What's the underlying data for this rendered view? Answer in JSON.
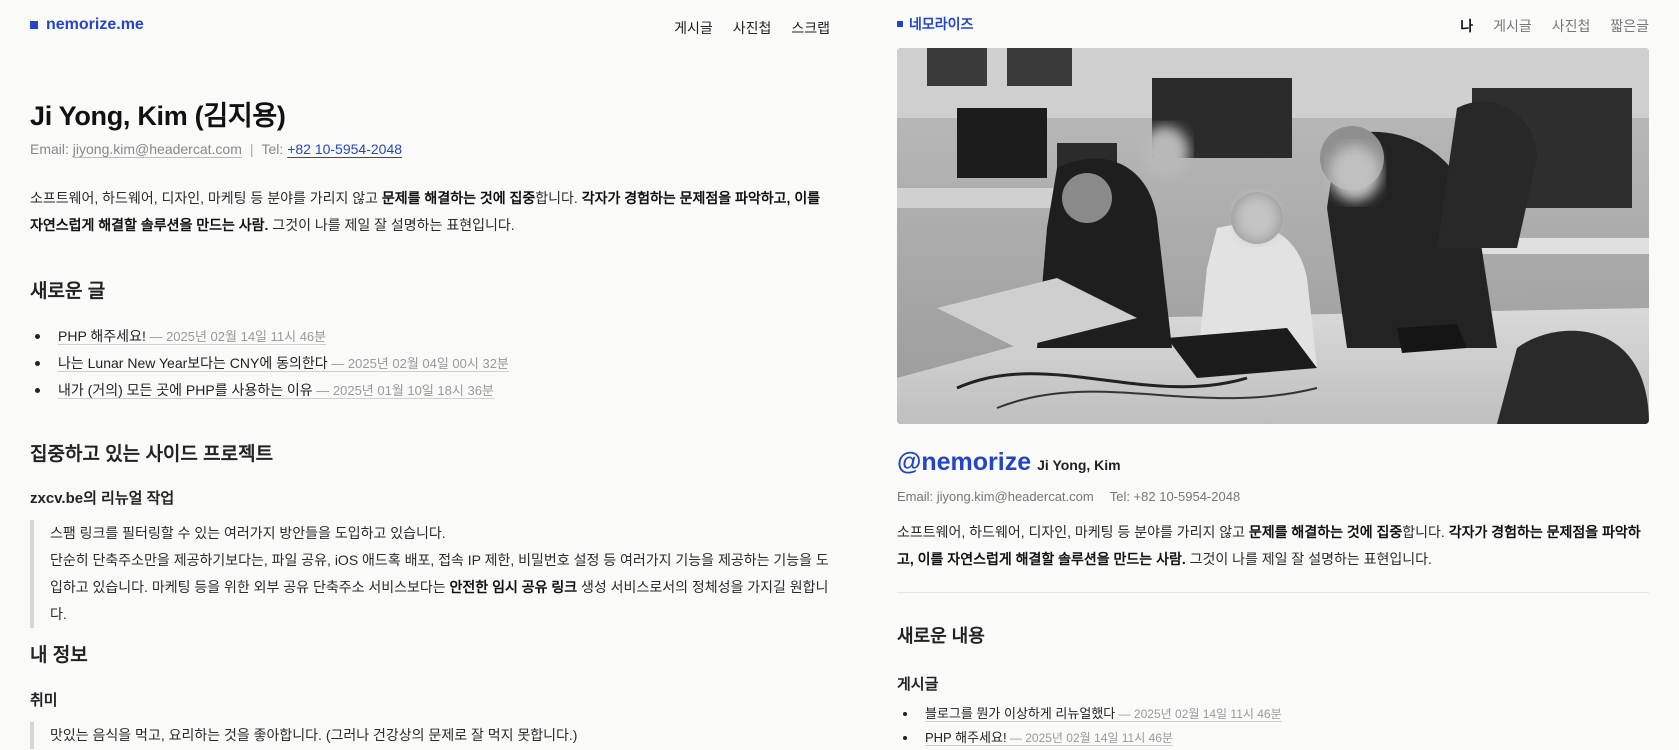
{
  "left": {
    "brand": "nemorize.me",
    "nav": [
      "게시글",
      "사진첩",
      "스크랩"
    ],
    "name": "Ji Yong, Kim (김지용)",
    "contact": {
      "email_label": "Email: ",
      "email": "jiyong.kim@headercat.com",
      "separator": "|",
      "tel_label": "Tel: ",
      "tel": "+82 10-5954-2048"
    },
    "intro": {
      "p1": "소프트웨어, 하드웨어, 디자인, 마케팅 등 분야를 가리지 않고 ",
      "b1": "문제를 해결하는 것에 집중",
      "p2": "합니다. ",
      "b2": "각자가 경험하는 문제점을 파악하고, 이를 자연스럽게 해결할 솔루션을 만드는 사람.",
      "p3": " 그것이 나를 제일 잘 설명하는 표현입니다."
    },
    "new_posts_heading": "새로운 글",
    "posts": [
      {
        "title": "PHP 해주세요!",
        "date": " — 2025년 02월 14일 11시 46분"
      },
      {
        "title": "나는 Lunar New Year보다는 CNY에 동의한다",
        "date": " — 2025년 02월 04일 00시 32분"
      },
      {
        "title": "내가 (거의) 모든 곳에 PHP를 사용하는 이유",
        "date": " — 2025년 01월 10일 18시 36분"
      }
    ],
    "projects_heading": "집중하고 있는 사이드 프로젝트",
    "project": {
      "title": "zxcv.be의 리뉴얼 작업",
      "line1": "스팸 링크를 필터링할 수 있는 여러가지 방안들을 도입하고 있습니다.",
      "line2a": "단순히 단축주소만을 제공하기보다는, 파일 공유, iOS 애드혹 배포, 접속 IP 제한, 비밀번호 설정 등 여러가지 기능을 제공하는 기능을 도입하고 있습니다. 마케팅 등을 위한 외부 공유 단축주소 서비스보다는 ",
      "line2b": "안전한 임시 공유 링크",
      "line2c": " 생성 서비스로서의 정체성을 가지길 원합니다."
    },
    "info_heading": "내 정보",
    "hobby_heading": "취미",
    "hobby_text": "맛있는 음식을 먹고, 요리하는 것을 좋아합니다. (그러나 건강상의 문제로 잘 먹지 못합니다.)"
  },
  "right": {
    "brand": "네모라이즈",
    "nav": [
      {
        "label": "나",
        "active": true
      },
      {
        "label": "게시글",
        "active": false
      },
      {
        "label": "사진첩",
        "active": false
      },
      {
        "label": "짧은글",
        "active": false
      }
    ],
    "handle": "@nemorize",
    "name": "Ji Yong, Kim",
    "contact": {
      "email": "Email:  jiyong.kim@headercat.com",
      "tel": "Tel:  +82 10-5954-2048"
    },
    "intro": {
      "p1": "소프트웨어, 하드웨어, 디자인, 마케팅 등 분야를 가리지 않고 ",
      "b1": "문제를 해결하는 것에 집중",
      "p2": "합니다. ",
      "b2": "각자가 경험하는 문제점을 파악하고, 이를 자연스럽게 해결할 솔루션을 만드는 사람.",
      "p3": " 그것이 나를 제일 잘 설명하는 표현입니다."
    },
    "new_content_heading": "새로운 내용",
    "posts_heading": "게시글",
    "posts": [
      {
        "title": "블로그를 뭔가 이상하게 리뉴얼했다",
        "date": " — 2025년 02월 14일 11시 46분"
      },
      {
        "title": "PHP 해주세요!",
        "date": " — 2025년 02월 14일 11시 46분"
      }
    ]
  },
  "colors": {
    "accent": "#2445c9",
    "background": "#fafaf9"
  }
}
